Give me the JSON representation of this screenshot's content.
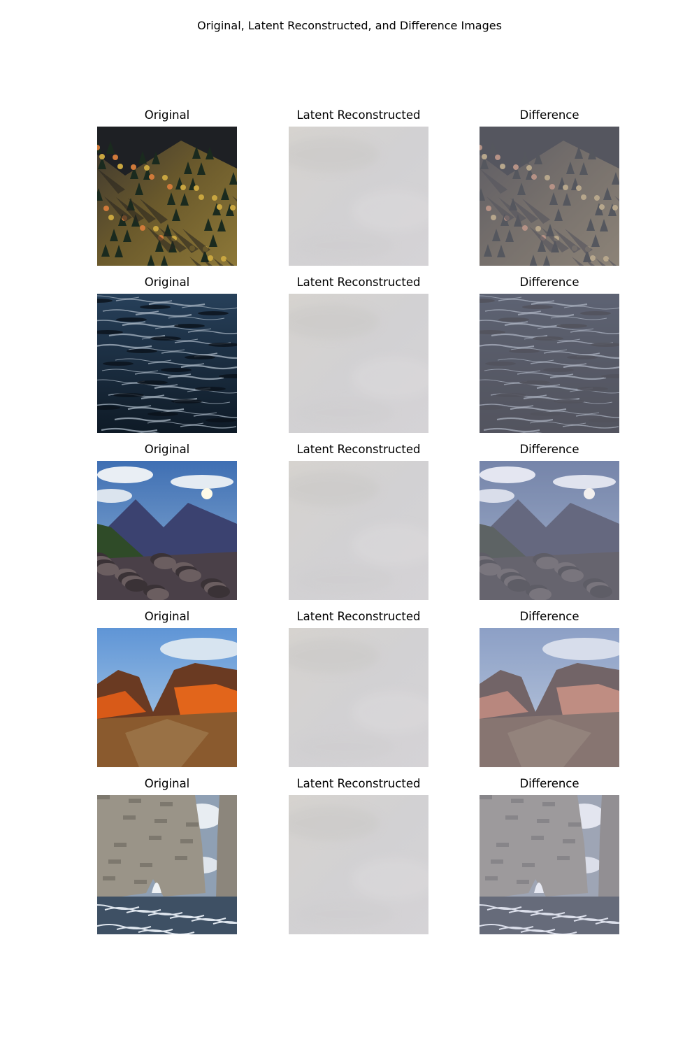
{
  "figure_title": "Original, Latent Reconstructed, and Difference Images",
  "column_titles": {
    "original": "Original",
    "reconstructed": "Latent Reconstructed",
    "difference": "Difference"
  },
  "rows": [
    {
      "scene": "forested-hillside"
    },
    {
      "scene": "ocean-water"
    },
    {
      "scene": "mountain-valley-sun"
    },
    {
      "scene": "red-mountains"
    },
    {
      "scene": "sea-rocks-arch"
    }
  ]
}
